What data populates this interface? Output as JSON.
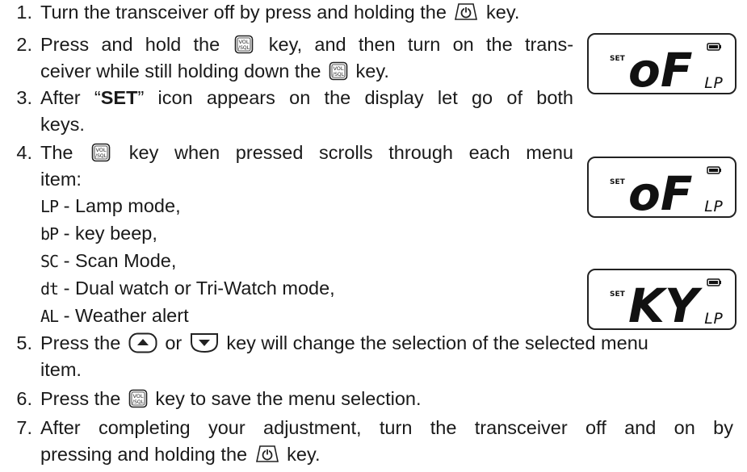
{
  "steps": [
    {
      "num": "1.",
      "a": "Turn the transceiver off by press and holding the",
      "b": "key."
    },
    {
      "num": "2.",
      "a": "Press and hold the",
      "b": "key, and then turn on the trans-",
      "c": "ceiver while still holding down the",
      "d": "key."
    },
    {
      "num": "3.",
      "a": "After “",
      "bold": "SET",
      "b": "” icon appears on the display let go of both",
      "c": "keys."
    },
    {
      "num": "4.",
      "a": "The",
      "b": "key when pressed scrolls through each menu",
      "c": "item:"
    },
    {
      "num": "5.",
      "a": "Press the",
      "or": "or",
      "b": "key will change the selection of the selected menu",
      "c": "item."
    },
    {
      "num": "6.",
      "a": "Press the",
      "b": "key to save the menu selection."
    },
    {
      "num": "7.",
      "a": "After completing your adjustment, turn the transceiver off and on by",
      "b": "pressing and holding the",
      "c": "key."
    }
  ],
  "menu_items": [
    {
      "code": "LP",
      "desc": " - Lamp mode,"
    },
    {
      "code": "bP",
      "desc": " - key beep,"
    },
    {
      "code": "SC",
      "desc": " - Scan Mode,"
    },
    {
      "code": "dt",
      "desc": " - Dual watch or Tri-Watch mode,"
    },
    {
      "code": "AL",
      "desc": " - Weather alert"
    }
  ],
  "icons": {
    "power": "power-key-icon",
    "vol_sql": "vol-sql-key-icon",
    "up": "up-arrow-key-icon",
    "down": "down-arrow-key-icon",
    "vol_label": "VOL",
    "sql_label": "/SQL"
  },
  "lcd_displays": [
    {
      "set_label": "SET",
      "main": "oF",
      "sub": "LP"
    },
    {
      "set_label": "SET",
      "main": "oF",
      "sub": "LP"
    },
    {
      "set_label": "SET",
      "main": "KY",
      "sub": "LP"
    }
  ]
}
